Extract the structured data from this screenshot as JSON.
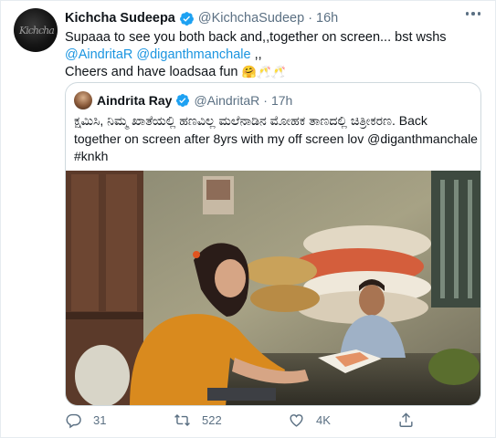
{
  "tweet": {
    "author_name": "Kichcha Sudeepa",
    "author_handle": "@KichchaSudeep",
    "separator": "·",
    "time": "16h",
    "avatar_signature": "Kichcha",
    "text_line1": "Supaaa to see you both back and,,together on screen... bst wshs",
    "mention1": "@AindritaR",
    "mention2": "@diganthmanchale",
    "after_mentions": " ,,",
    "text_line3": "Cheers and have loadsaa fun",
    "emojis": "🤗🥂🥂"
  },
  "quoted": {
    "author_name": "Aindrita Ray",
    "author_handle": "@AindritaR",
    "separator": "·",
    "time": "17h",
    "line1": "ಕ್ಷಮಿಸಿ, ನಿಮ್ಮ ಖಾತೆಯಲ್ಲಿ ಹಣವಿಲ್ಲ ಮಲೆನಾಡಿನ ಮೋಹಕ ತಾಣದಲ್ಲಿ ಚಿತ್ರೀಕರಣ. Back",
    "line2_prefix": "together on screen after 8yrs with my off screen lov ",
    "line2_mention": "@diganthmanchale",
    "hashtag": "#knkh"
  },
  "actions": {
    "replies": "31",
    "retweets": "522",
    "likes": "4K"
  },
  "icons": [
    "verified-badge-icon",
    "more-options-icon",
    "reply-icon",
    "retweet-icon",
    "like-icon",
    "share-icon"
  ],
  "colors": {
    "link": "#1b95e0",
    "muted": "#5b7083",
    "verified": "#1da1f2",
    "border": "#cfd9de"
  }
}
